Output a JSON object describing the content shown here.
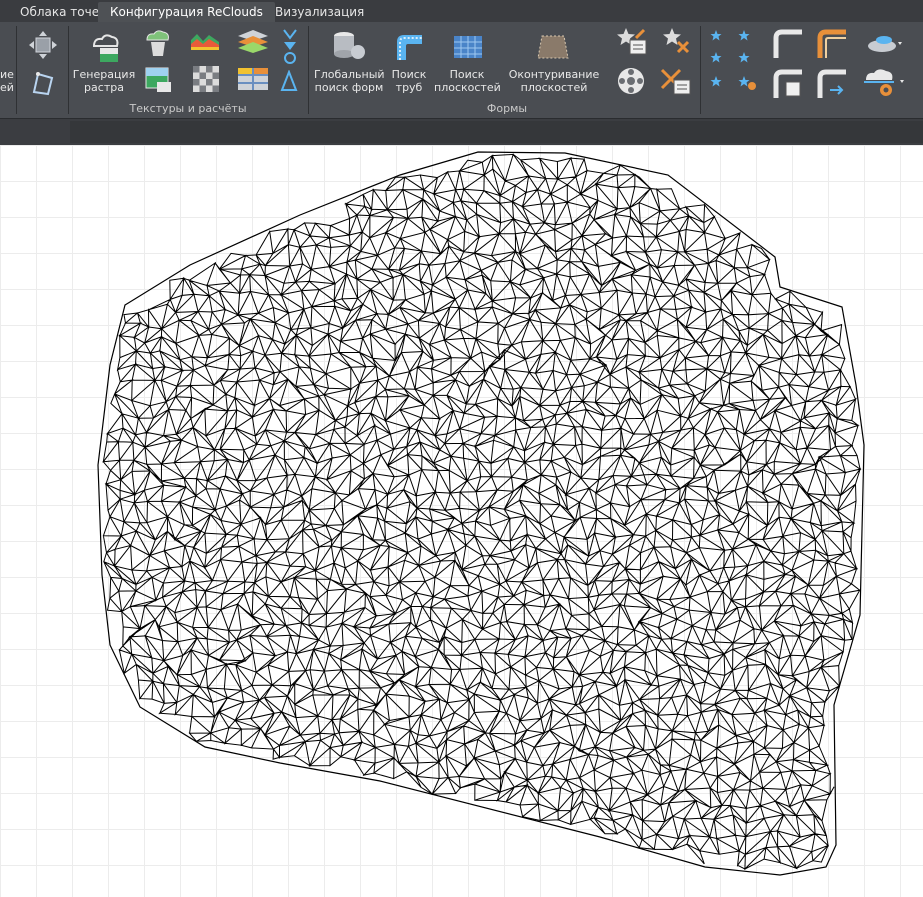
{
  "tabs": [
    {
      "label": "Облака точек",
      "active": false
    },
    {
      "label": "Конфигурация ReClouds",
      "active": true
    },
    {
      "label": "Визуализация",
      "active": false
    }
  ],
  "ribbon": {
    "left_cut": {
      "label_line1": "ие",
      "label_line2": "ей"
    },
    "textures_group": {
      "label": "Текстуры и расчёты",
      "raster_button": {
        "line1": "Генерация",
        "line2": "растра"
      }
    },
    "forms_group": {
      "label": "Формы",
      "global_search": {
        "line1": "Глобальный",
        "line2": "поиск форм"
      },
      "pipe_search": {
        "line1": "Поиск",
        "line2": "труб"
      },
      "plane_search": {
        "line1": "Поиск",
        "line2": "плоскостей"
      },
      "plane_contour": {
        "line1": "Оконтуривание",
        "line2": "плоскостей"
      }
    }
  },
  "icons": [
    "move-icon",
    "shape-icon",
    "cloud-raster-icon",
    "cloud-globe-icon",
    "terrain-icon",
    "layers-icon",
    "raster-image-icon",
    "checker-icon",
    "table-grid-icon",
    "cylinder-icon",
    "pipe-search-icon",
    "plane-search-icon",
    "plane-contour-icon",
    "star-edit-icon",
    "star-remove-icon",
    "wheel-icon",
    "cross-remove-icon",
    "stars-group-icon",
    "corner-icon",
    "elbow-icon",
    "disk-icon",
    "gear-cloud-icon"
  ],
  "colors": {
    "ribbon": "#4a4d52",
    "tabbar": "#3a3c40",
    "accent": "#e8903a",
    "mesh": "#000000"
  },
  "viewport": {
    "content": "triangulated mesh"
  }
}
